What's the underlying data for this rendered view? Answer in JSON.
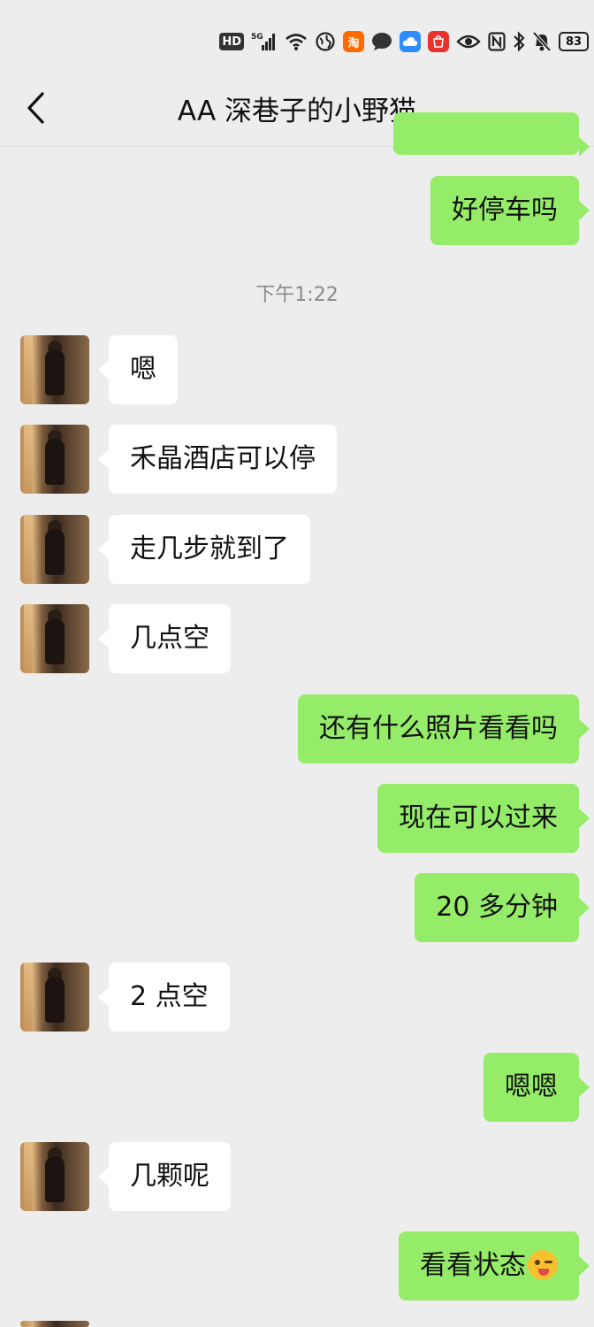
{
  "status_bar": {
    "hd": "HD",
    "signal": "5G",
    "battery": "83",
    "icons": [
      "hd-icon",
      "signal-5g-icon",
      "wifi-icon",
      "vpn-globe-icon",
      "taobao-app-icon",
      "message-bubble-icon",
      "cloud-app-icon",
      "shop-app-icon",
      "eye-icon",
      "nfc-icon",
      "bluetooth-icon",
      "mute-bell-icon",
      "battery-icon"
    ]
  },
  "header": {
    "title": "AA 深巷子的小野猫",
    "back_icon": "chevron-left-icon"
  },
  "messages": [
    {
      "side": "out",
      "text": "好停车吗"
    },
    {
      "timestamp": "下午1:22"
    },
    {
      "side": "in",
      "text": "嗯"
    },
    {
      "side": "in",
      "text": "禾晶酒店可以停"
    },
    {
      "side": "in",
      "text": "走几步就到了"
    },
    {
      "side": "in",
      "text": "几点空"
    },
    {
      "side": "out",
      "text": "还有什么照片看看吗"
    },
    {
      "side": "out",
      "text": "现在可以过来"
    },
    {
      "side": "out",
      "text": "20 多分钟"
    },
    {
      "side": "in",
      "text": "2 点空"
    },
    {
      "side": "out",
      "text": "嗯嗯"
    },
    {
      "side": "in",
      "text": "几颗呢"
    },
    {
      "side": "out",
      "text": "看看状态",
      "emoji": "winking-tongue-emoji"
    }
  ]
}
